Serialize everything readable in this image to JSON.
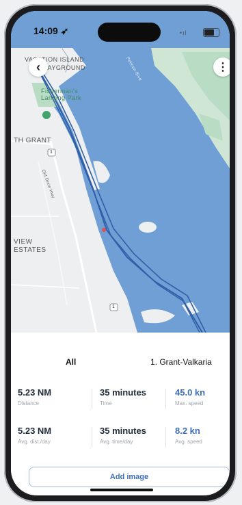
{
  "status_bar": {
    "time": "14:09 ➶",
    "signal": "•ıl"
  },
  "map": {
    "labels": {
      "vacation_island": "VACATION ISLAND",
      "playground": "LAYGROUND",
      "fishermans_line1": "Fisherman's",
      "fishermans_line2": "Landing Park",
      "grant": "TH GRANT",
      "road_1a": "1",
      "old_dixie": "Old Dixie Hwy",
      "view": "VIEW",
      "estates": "ESTATES",
      "road_1b": "1",
      "north_blvd": "Pelican Blvd"
    },
    "colors": {
      "water": "#6f9fd4",
      "land": "#eeeff0",
      "green": "#b9dcc4",
      "track": "#2f5fa8"
    }
  },
  "trip": {
    "tabs": {
      "all": "All",
      "segment": "1. Grant-Valkaria"
    },
    "stats_row1": [
      {
        "value": "5.23 NM",
        "label": "Distance"
      },
      {
        "value": "35 minutes",
        "label": "Time"
      },
      {
        "value": "45.0 kn",
        "label": "Max. speed"
      }
    ],
    "stats_row2": [
      {
        "value": "5.23 NM",
        "label": "Avg. dist./day"
      },
      {
        "value": "35 minutes",
        "label": "Avg. time/day"
      },
      {
        "value": "8.2 kn",
        "label": "Avg. speed"
      }
    ],
    "add_image": "Add image"
  },
  "icons": {
    "back": "chevron-left-icon",
    "menu": "more-vertical-icon"
  }
}
